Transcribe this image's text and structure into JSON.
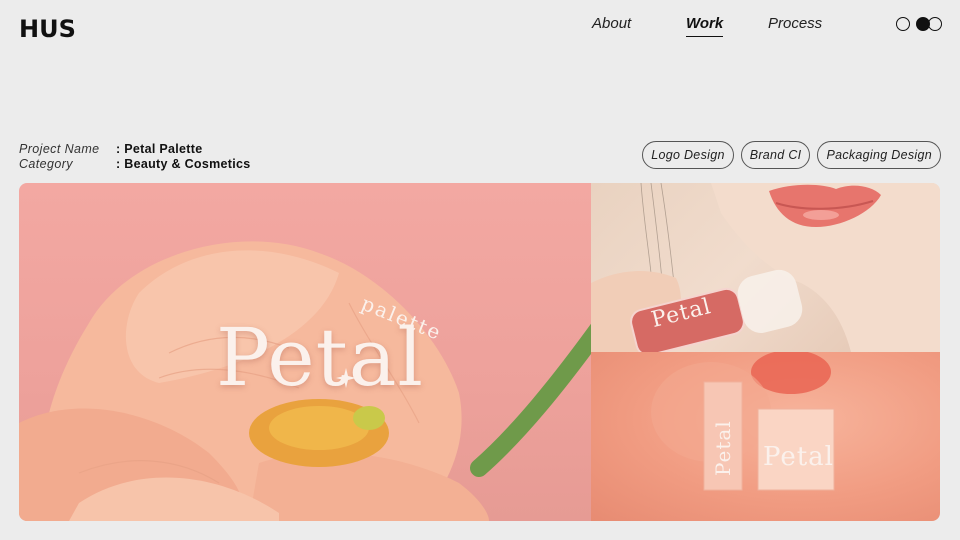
{
  "brand": {
    "logo": "HUS"
  },
  "nav": {
    "items": [
      "About",
      "Work",
      "Process"
    ],
    "active": "Work"
  },
  "project": {
    "name_label": "Project Name",
    "name_value": ": Petal Palette",
    "category_label": "Category",
    "category_value": ": Beauty & Cosmetics"
  },
  "tags": [
    "Logo Design",
    "Brand CI",
    "Packaging Design"
  ],
  "gallery": {
    "hero_wordmark": "Petal",
    "hero_sub": "palette",
    "lipgloss_wordmark": "Petal",
    "box_wordmark_tall": "Petal",
    "box_wordmark_wide": "Petal"
  }
}
